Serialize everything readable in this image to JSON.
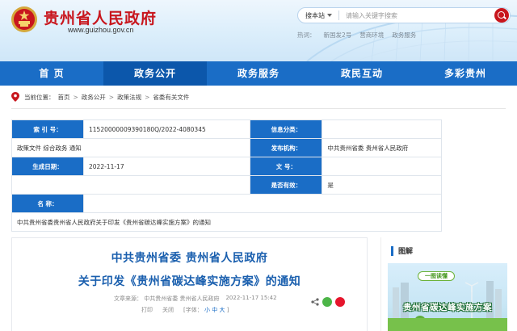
{
  "header": {
    "site_title": "贵州省人民政府",
    "site_url": "www.guizhou.gov.cn"
  },
  "search": {
    "scope_label": "搜本站",
    "placeholder": "请输入关键字搜索",
    "hot_label": "热词：",
    "hot_words": [
      "新国发2号",
      "营商环境",
      "政务服务"
    ]
  },
  "nav": {
    "items": [
      "首 页",
      "政务公开",
      "政务服务",
      "政民互动",
      "多彩贵州"
    ],
    "active_index": 1
  },
  "breadcrumb": {
    "prefix": "当前位置：",
    "items": [
      "首页",
      "政务公开",
      "政策法规",
      "省委有关文件"
    ],
    "separator": ">"
  },
  "info": {
    "index_label": "索  引  号：",
    "index_value": "11520000009390180Q/2022-4080345",
    "category_label": "信息分类：",
    "category_value": "政策文件    综合政务    通知",
    "issuer_label": "发布机构：",
    "issuer_value": "中共贵州省委 贵州省人民政府",
    "date_label": "生成日期：",
    "date_value": "2022-11-17",
    "docno_label": "文      号：",
    "docno_value": "",
    "valid_label": "是否有效：",
    "valid_value": "是",
    "name_label": "名      称：",
    "name_value": "中共贵州省委贵州省人民政府关于印发《贵州省碳达峰实施方案》的通知"
  },
  "article": {
    "title_line1": "中共贵州省委 贵州省人民政府",
    "title_line2": "关于印发《贵州省碳达峰实施方案》的通知",
    "source_label": "文章来源：",
    "source_value": "中共贵州省委 贵州省人民政府",
    "published": "2022-11-17 15:42",
    "print_label": "打印",
    "close_label": "关闭",
    "font_label": "[字体：",
    "font_small": "小",
    "font_medium": "中",
    "font_large": "大",
    "font_close": "]"
  },
  "sidebar": {
    "title": "图解",
    "poster_badge": "一图读懂",
    "poster_title": "贵州省碳达峰实施方案"
  },
  "colors": {
    "brand_red": "#c8161d",
    "nav_blue": "#1a6dc6",
    "nav_active": "#0c57ab",
    "title_blue": "#1a5fae"
  }
}
